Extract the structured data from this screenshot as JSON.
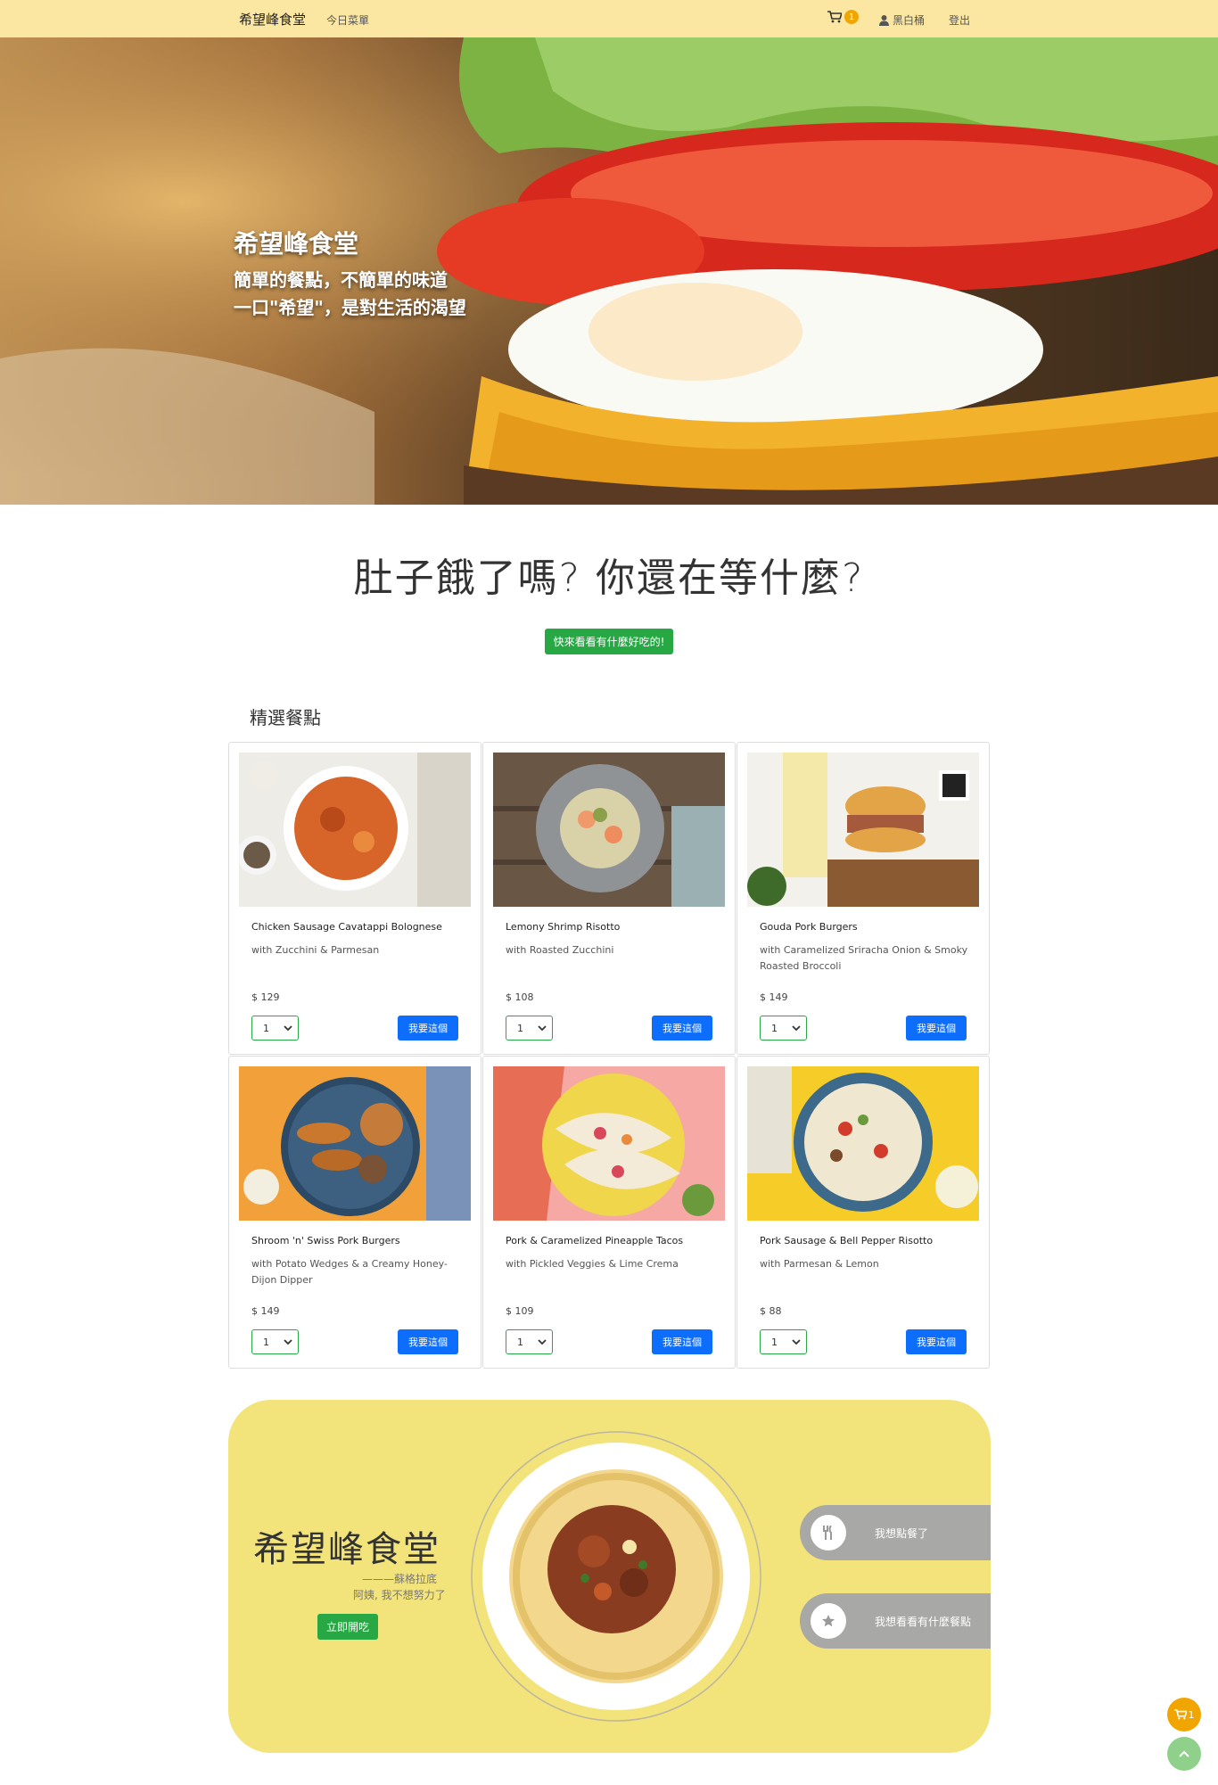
{
  "nav": {
    "brand": "希望峰食堂",
    "menu_link": "今日菜單",
    "cart_count": "1",
    "user_name": "黑白桶",
    "logout": "登出"
  },
  "hero": {
    "title": "希望峰食堂",
    "line1": "簡單的餐點，不簡單的味道",
    "line2": "一口\"希望\"，是對生活的渴望"
  },
  "headline": "肚子餓了嗎? 你還在等什麼?",
  "cta": "快來看看有什麼好吃的!",
  "section_title": "精選餐點",
  "products": [
    {
      "name": "Chicken Sausage Cavatappi Bolognese",
      "sub": "with Zucchini & Parmesan",
      "price": "$ 129",
      "qty": "1",
      "button": "我要這個"
    },
    {
      "name": "Lemony Shrimp Risotto",
      "sub": "with Roasted Zucchini",
      "price": "$ 108",
      "qty": "1",
      "button": "我要這個"
    },
    {
      "name": "Gouda Pork Burgers",
      "sub": "with Caramelized Sriracha Onion & Smoky Roasted Broccoli",
      "price": "$ 149",
      "qty": "1",
      "button": "我要這個"
    },
    {
      "name": "Shroom 'n' Swiss Pork Burgers",
      "sub": "with Potato Wedges & a Creamy Honey-Dijon Dipper",
      "price": "$ 149",
      "qty": "1",
      "button": "我要這個"
    },
    {
      "name": "Pork & Caramelized Pineapple Tacos",
      "sub": "with Pickled Veggies & Lime Crema",
      "price": "$ 109",
      "qty": "1",
      "button": "我要這個"
    },
    {
      "name": "Pork Sausage & Bell Pepper Risotto",
      "sub": "with Parmesan & Lemon",
      "price": "$ 88",
      "qty": "1",
      "button": "我要這個"
    }
  ],
  "banner": {
    "title": "希望峰食堂",
    "credit": "———蘇格拉底",
    "quote": "阿姨, 我不想努力了",
    "button": "立即開吃",
    "pill1": "我想點餐了",
    "pill2": "我想看看有什麼餐點"
  },
  "floating": {
    "cart_count": "1"
  },
  "colors": {
    "nav_bg": "#fbe7a1",
    "green": "#28a745",
    "blue": "#0d6efd",
    "badge": "#f0a500",
    "banner_bg": "#f2e37a"
  }
}
